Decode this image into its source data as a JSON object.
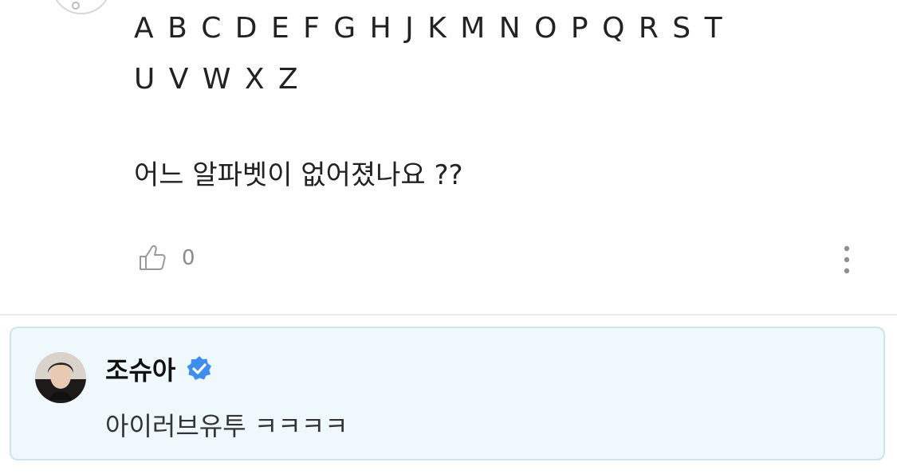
{
  "comment": {
    "alphabet_line_1": "A B C D E F G H J K M N O P Q R S T",
    "alphabet_line_2": "U V W X Z",
    "question": "어느 알파벳이 없어졌나요 ??",
    "like_count": "0",
    "icons": {
      "like": "thumbs-up-icon",
      "more": "more-vertical-icon"
    }
  },
  "reply": {
    "author_name": "조슈아",
    "verified": true,
    "text": "아이러브유투 ㅋㅋㅋㅋ",
    "icons": {
      "verified": "verified-badge-icon"
    },
    "colors": {
      "card_background": "#eef8fd",
      "card_border": "#cfe3ec",
      "verified_blue": "#3d8ef0"
    }
  }
}
